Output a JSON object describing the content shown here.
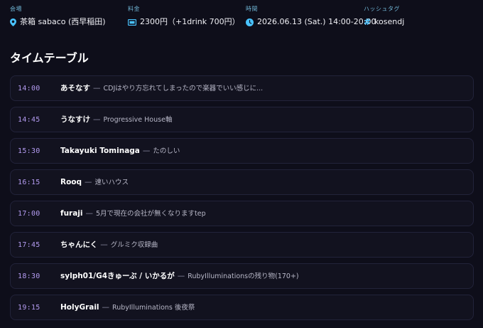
{
  "info": {
    "venue": {
      "label": "会場",
      "value": "茶箱 sabaco (西早稲田)",
      "icon": "location-pin-icon"
    },
    "fee": {
      "label": "料金",
      "value": "2300円（+1drink 700円）",
      "icon": "ticket-icon"
    },
    "time": {
      "label": "時間",
      "value": "2026.06.13 (Sat.) 14:00-20:00",
      "icon": "clock-icon"
    },
    "hashtag": {
      "label": "ハッシュタグ",
      "value": "kosendj",
      "icon": "hash-icon"
    }
  },
  "section_title": "タイムテーブル",
  "separator": "—",
  "timetable": [
    {
      "time": "14:00",
      "name": "あそなす",
      "desc": "CDJはやり方忘れてしまったので楽器でいい感じに..."
    },
    {
      "time": "14:45",
      "name": "うなすけ",
      "desc": "Progressive House軸"
    },
    {
      "time": "15:30",
      "name": "Takayuki Tominaga",
      "desc": "たのしい"
    },
    {
      "time": "16:15",
      "name": "Rooq",
      "desc": "速いハウス"
    },
    {
      "time": "17:00",
      "name": "furaji",
      "desc": "5月で現在の会社が無くなりますtep"
    },
    {
      "time": "17:45",
      "name": "ちゃんにく",
      "desc": "グルミク収録曲"
    },
    {
      "time": "18:30",
      "name": "sylph01/G4きゅーぶ / いかるが",
      "desc": "RubyIlluminationsの残り物(170+)"
    },
    {
      "time": "19:15",
      "name": "HolyGrail",
      "desc": "RubyIlluminations 後夜祭"
    }
  ],
  "colors": {
    "accent_icon": "#49c3ff",
    "label": "#6fb3d2",
    "time": "#b39bf0",
    "background": "#0e0e1a"
  }
}
